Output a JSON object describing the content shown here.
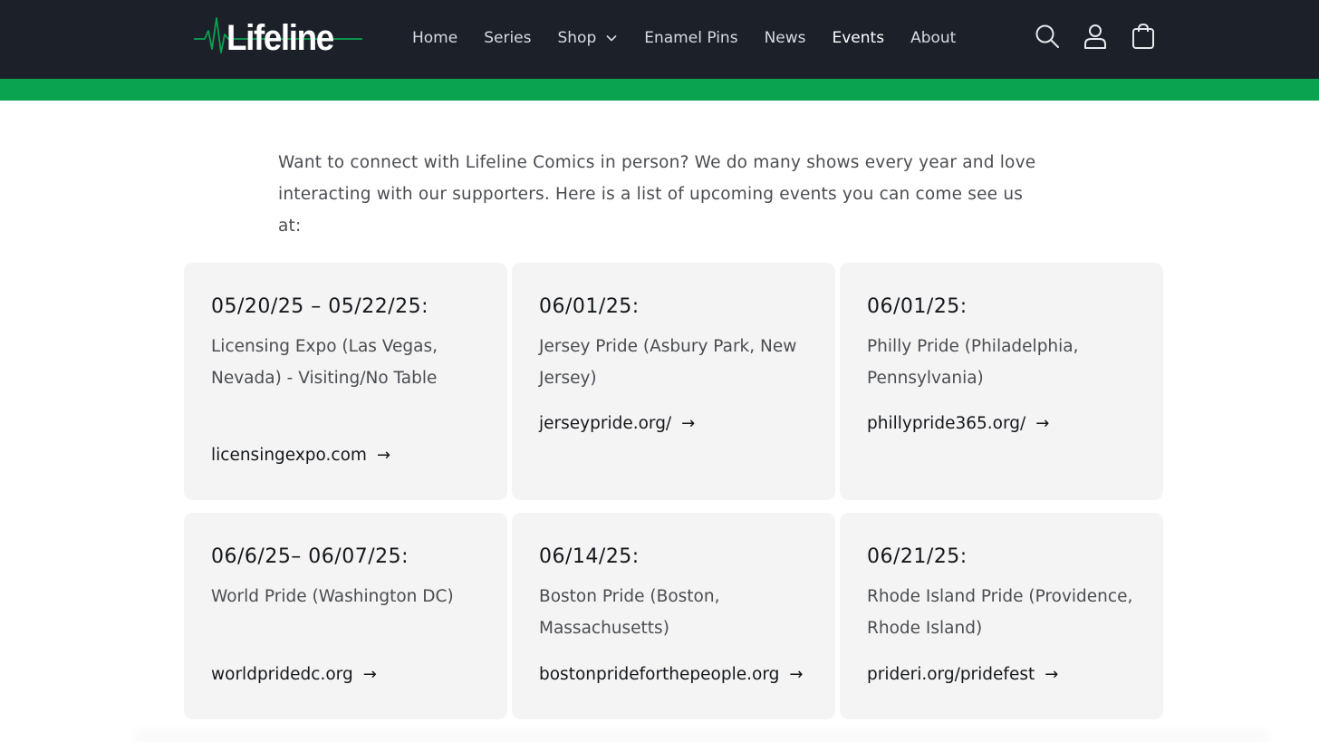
{
  "header": {
    "logo_text": "Lifeline",
    "nav": [
      {
        "label": "Home"
      },
      {
        "label": "Series"
      },
      {
        "label": "Shop"
      },
      {
        "label": "Enamel Pins"
      },
      {
        "label": "News"
      },
      {
        "label": "Events"
      },
      {
        "label": "About"
      }
    ],
    "active_nav": "Events",
    "icons": [
      "search-icon",
      "account-icon",
      "cart-icon"
    ]
  },
  "colors": {
    "header_bg": "#1b2029",
    "accent_green": "#0aa34f",
    "card_bg": "#f4f4f4"
  },
  "intro": {
    "text": "Want to connect with Lifeline Comics in person? We do many shows every year and love interacting with our supporters. Here is a list of upcoming events you can come see us at:"
  },
  "events": [
    {
      "date": "05/20/25 – 05/22/25:",
      "description": "Licensing Expo (Las Vegas, Nevada) - Visiting/No Table",
      "link": "licensingexpo.com"
    },
    {
      "date": "06/01/25:",
      "description": "Jersey Pride (Asbury Park, New Jersey)",
      "link": "jerseypride.org/"
    },
    {
      "date": "06/01/25:",
      "description": "Philly Pride (Philadelphia, Pennsylvania)",
      "link": "phillypride365.org/"
    },
    {
      "date": "06/6/25– 06/07/25:",
      "description": "World Pride (Washington DC)",
      "link": "worldpridedc.org"
    },
    {
      "date": "06/14/25:",
      "description": "Boston Pride (Boston, Massachusetts)",
      "link": "bostonprideforthepeople.org"
    },
    {
      "date": "06/21/25:",
      "description": "Rhode Island Pride (Providence, Rhode Island)",
      "link": "prideri.org/pridefest"
    }
  ]
}
